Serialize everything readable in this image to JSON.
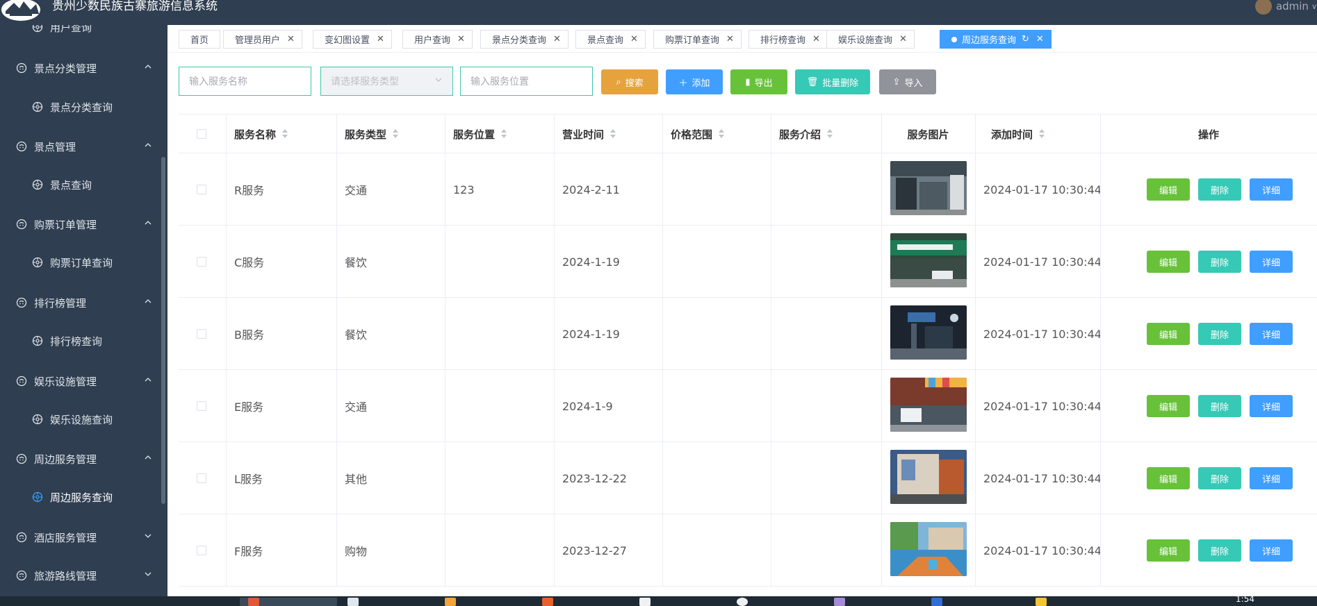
{
  "app": {
    "title": "贵州少数民族古寨旅游信息系统",
    "user": "admin"
  },
  "sidebar": {
    "items": [
      {
        "type": "sub",
        "label": "用户查询",
        "icon": "gear-circle-icon"
      },
      {
        "type": "group",
        "label": "景点分类管理",
        "icon": "smile-circle-icon",
        "expanded": true
      },
      {
        "type": "sub",
        "label": "景点分类查询",
        "icon": "gear-circle-icon"
      },
      {
        "type": "group",
        "label": "景点管理",
        "icon": "smile-circle-icon",
        "expanded": true
      },
      {
        "type": "sub",
        "label": "景点查询",
        "icon": "gear-circle-icon"
      },
      {
        "type": "group",
        "label": "购票订单管理",
        "icon": "smile-circle-icon",
        "expanded": true
      },
      {
        "type": "sub",
        "label": "购票订单查询",
        "icon": "gear-circle-icon"
      },
      {
        "type": "group",
        "label": "排行榜管理",
        "icon": "smile-circle-icon",
        "expanded": true
      },
      {
        "type": "sub",
        "label": "排行榜查询",
        "icon": "gear-circle-icon"
      },
      {
        "type": "group",
        "label": "娱乐设施管理",
        "icon": "smile-circle-icon",
        "expanded": true
      },
      {
        "type": "sub",
        "label": "娱乐设施查询",
        "icon": "gear-circle-icon"
      },
      {
        "type": "group",
        "label": "周边服务管理",
        "icon": "smile-circle-icon",
        "expanded": true
      },
      {
        "type": "sub",
        "label": "周边服务查询",
        "icon": "gear-circle-icon",
        "active": true
      },
      {
        "type": "group",
        "label": "酒店服务管理",
        "icon": "smile-circle-icon",
        "expanded": false
      },
      {
        "type": "group",
        "label": "旅游路线管理",
        "icon": "smile-circle-icon",
        "expanded": false
      }
    ]
  },
  "tabs": [
    {
      "label": "首页",
      "closable": false
    },
    {
      "label": "管理员用户",
      "closable": true
    },
    {
      "label": "变幻图设置",
      "closable": true
    },
    {
      "label": "用户查询",
      "closable": true
    },
    {
      "label": "景点分类查询",
      "closable": true
    },
    {
      "label": "景点查询",
      "closable": true
    },
    {
      "label": "购票订单查询",
      "closable": true
    },
    {
      "label": "排行榜查询",
      "closable": true
    },
    {
      "label": "娱乐设施查询",
      "closable": true
    },
    {
      "label": "周边服务查询",
      "closable": true,
      "active": true
    }
  ],
  "search": {
    "name_placeholder": "输入服务名称",
    "type_placeholder": "请选择服务类型",
    "location_placeholder": "输入服务位置"
  },
  "toolbar": {
    "search_label": "搜索",
    "add_label": "添加",
    "export_label": "导出",
    "batch_delete_label": "批量删除",
    "import_label": "导入"
  },
  "colors": {
    "sidebar_bg": "#2f3e50",
    "accent": "#409eff",
    "search_btn": "#e6a23c",
    "add_btn": "#409eff",
    "export_btn": "#67c23a",
    "batch_delete_btn": "#36c9b6",
    "import_btn": "#909399",
    "edit_btn": "#67c23a",
    "delete_btn": "#36c9b6",
    "detail_btn": "#409eff"
  },
  "table": {
    "columns": [
      "服务名称",
      "服务类型",
      "服务位置",
      "营业时间",
      "价格范围",
      "服务介绍",
      "服务图片",
      "添加时间",
      "操作"
    ],
    "rows": [
      {
        "name": "R服务",
        "type": "交通",
        "location": "123",
        "hours": "2024-2-11",
        "price": "",
        "intro": "",
        "added": "2024-01-17 10:30:44"
      },
      {
        "name": "C服务",
        "type": "餐饮",
        "location": "",
        "hours": "2024-1-19",
        "price": "",
        "intro": "",
        "added": "2024-01-17 10:30:44"
      },
      {
        "name": "B服务",
        "type": "餐饮",
        "location": "",
        "hours": "2024-1-19",
        "price": "",
        "intro": "",
        "added": "2024-01-17 10:30:44"
      },
      {
        "name": "E服务",
        "type": "交通",
        "location": "",
        "hours": "2024-1-9",
        "price": "",
        "intro": "",
        "added": "2024-01-17 10:30:44"
      },
      {
        "name": "L服务",
        "type": "其他",
        "location": "",
        "hours": "2023-12-22",
        "price": "",
        "intro": "",
        "added": "2024-01-17 10:30:44"
      },
      {
        "name": "F服务",
        "type": "购物",
        "location": "",
        "hours": "2023-12-27",
        "price": "",
        "intro": "",
        "added": "2024-01-17 10:30:44"
      }
    ],
    "actions": {
      "edit": "编辑",
      "delete": "删除",
      "detail": "详细"
    }
  },
  "taskbar": {
    "clock": "1:54"
  }
}
